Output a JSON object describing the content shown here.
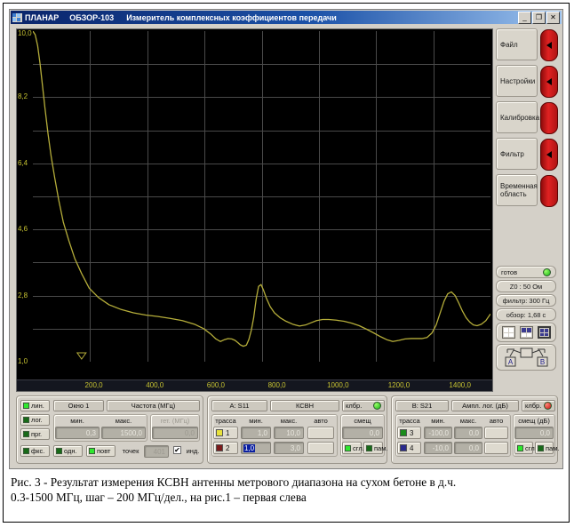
{
  "window": {
    "brand": "ПЛАНАР",
    "model": "ОБЗОР-103",
    "subtitle": "Измеритель комплексных коэффициентов передачи",
    "logo_icon": "planar-logo-icon",
    "buttons": [
      {
        "name": "minimize-button",
        "glyph": "_"
      },
      {
        "name": "maximize-button",
        "glyph": "❐"
      },
      {
        "name": "close-button",
        "glyph": "✕"
      }
    ]
  },
  "side_menu": [
    {
      "label": "Файл",
      "key_icon": "triangle-left-icon",
      "has_arrow": true
    },
    {
      "label": "Настройки",
      "key_icon": "triangle-left-icon",
      "has_arrow": true
    },
    {
      "label": "Калибровка",
      "key_icon": "red-key-icon",
      "has_arrow": false
    },
    {
      "label": "Фильтр",
      "key_icon": "triangle-left-icon",
      "has_arrow": true
    },
    {
      "label": "Временная область",
      "key_icon": "red-key-icon",
      "has_arrow": false
    }
  ],
  "status": {
    "ready": "готов",
    "ready_led": "green",
    "impedance": "Z0 : 50  Ом",
    "filter": "фильтр: 300 Гц",
    "sweep": "обзор: 1,68 с",
    "layout_icons": [
      "layout-2x2-a-icon",
      "layout-2x2-b-icon",
      "layout-2x2-c-icon"
    ],
    "layout_selected": 2,
    "dut_icon": "dut-diagram-icon",
    "dut_port_a": "A",
    "dut_port_b": "B"
  },
  "panel_left": {
    "sweep_modes": [
      {
        "label": "лин.",
        "active": true
      },
      {
        "label": "лог.",
        "active": false
      },
      {
        "label": "прг.",
        "active": false
      },
      {
        "label": "фкс.",
        "active": false
      }
    ],
    "window_label": "Окно 1",
    "param_label": "Частота (МГц)",
    "col_min": "мин.",
    "col_max": "макс.",
    "col_gen": "гет. (МГц)",
    "val_min": "0,3",
    "val_max": "1500,0",
    "val_gen": "0,0",
    "trigger_single": "одн.",
    "trigger_repeat": "повт",
    "points_label": "точек",
    "points_value": "401",
    "ind_label": "инд.",
    "ind_checked": "✔"
  },
  "panel_a": {
    "channel": "A: S11",
    "format": "КСВН",
    "calib_label": "клбр.",
    "calib_led": "green",
    "col_trace": "трасса",
    "col_min": "мин.",
    "col_max": "макс.",
    "col_auto": "авто",
    "col_offset": "смещ",
    "offset_value": "0,0",
    "rows": [
      {
        "trace": "1",
        "color": "#e8e23a",
        "min": "1,0",
        "max": "10,0",
        "selected": false
      },
      {
        "trace": "2",
        "color": "#7b1a1a",
        "min": "1,0",
        "max": "3,0",
        "selected": true
      }
    ],
    "smooth_label": "сгл.",
    "memory_label": "пам."
  },
  "panel_b": {
    "channel": "B: S21",
    "format": "Ампл. лог. (дБ)",
    "calib_label": "клбр.",
    "calib_led": "red",
    "col_trace": "трасса",
    "col_min": "мин.",
    "col_max": "макс.",
    "col_auto": "авто",
    "col_offset": "смещ (дБ)",
    "offset_value": "0,0",
    "rows": [
      {
        "trace": "3",
        "color": "#1b8c1b",
        "min": "-100,0",
        "max": "0,0",
        "selected": false
      },
      {
        "trace": "4",
        "color": "#2a2a8c",
        "min": "-10,0",
        "max": "0,0",
        "selected": false
      }
    ],
    "smooth_label": "сгл.",
    "memory_label": "пам."
  },
  "caption": {
    "line1": "Рис. 3 - Результат измерения КСВН антенны метрового диапазона на сухом бетоне в д.ч.",
    "line2": "0.3-1500 МГц, шаг – 200 МГц/дел., на рис.1 – первая слева"
  },
  "chart_data": {
    "type": "line",
    "title": "",
    "xlabel": "Частота (МГц)",
    "ylabel": "КСВН",
    "trace_color": "#b5ad3a",
    "background": "#000000",
    "grid": true,
    "grid_color": "#4a4a4a",
    "grid_cols": 8,
    "grid_rows": 10,
    "xlim": [
      0.3,
      1500.0
    ],
    "ylim": [
      1.0,
      10.0
    ],
    "xticks": [
      200.0,
      400.0,
      600.0,
      800.0,
      1000.0,
      1200.0,
      1400.0
    ],
    "xticklabels": [
      "200,0",
      "400,0",
      "600,0",
      "800,0",
      "1000,0",
      "1200,0",
      "1400,0"
    ],
    "yticks": [
      1.0,
      2.8,
      4.6,
      6.4,
      8.2,
      10.0
    ],
    "yticklabels": [
      "1,0",
      "2,8",
      "4,6",
      "6,4",
      "8,2",
      "10,0"
    ],
    "marker": {
      "name": "start-marker",
      "x": 160.0,
      "icon": "triangle-down-icon"
    },
    "x": [
      0.3,
      8,
      16,
      24,
      32,
      40,
      50,
      60,
      72,
      85,
      100,
      118,
      138,
      160,
      185,
      215,
      250,
      290,
      330,
      370,
      410,
      450,
      490,
      530,
      560,
      585,
      600,
      615,
      628,
      640,
      652,
      663,
      672,
      680,
      690,
      700,
      708,
      716,
      724,
      732,
      740,
      748,
      756,
      766,
      778,
      792,
      810,
      830,
      852,
      874,
      894,
      912,
      930,
      950,
      970,
      995,
      1020,
      1045,
      1070,
      1095,
      1118,
      1140,
      1160,
      1180,
      1200,
      1220,
      1240,
      1258,
      1275,
      1292,
      1308,
      1322,
      1336,
      1348,
      1360,
      1372,
      1384,
      1396,
      1408,
      1420,
      1432,
      1444,
      1456,
      1470,
      1485,
      1500
    ],
    "y": [
      10.0,
      9.9,
      9.6,
      9.1,
      8.5,
      7.9,
      7.2,
      6.6,
      6.0,
      5.4,
      4.8,
      4.3,
      3.8,
      3.4,
      3.0,
      2.75,
      2.55,
      2.42,
      2.33,
      2.27,
      2.23,
      2.18,
      2.12,
      2.02,
      1.9,
      1.74,
      1.62,
      1.55,
      1.6,
      1.63,
      1.62,
      1.58,
      1.52,
      1.46,
      1.42,
      1.45,
      1.6,
      1.85,
      2.2,
      2.7,
      3.05,
      3.1,
      2.95,
      2.72,
      2.5,
      2.33,
      2.2,
      2.1,
      2.02,
      1.97,
      2.0,
      2.06,
      2.12,
      2.15,
      2.15,
      2.13,
      2.1,
      2.05,
      1.98,
      1.88,
      1.78,
      1.68,
      1.6,
      1.55,
      1.58,
      1.62,
      1.63,
      1.63,
      1.63,
      1.66,
      1.78,
      2.0,
      2.35,
      2.65,
      2.85,
      2.9,
      2.8,
      2.6,
      2.38,
      2.2,
      2.08,
      2.0,
      1.98,
      2.02,
      2.12,
      2.3,
      2.55
    ]
  }
}
